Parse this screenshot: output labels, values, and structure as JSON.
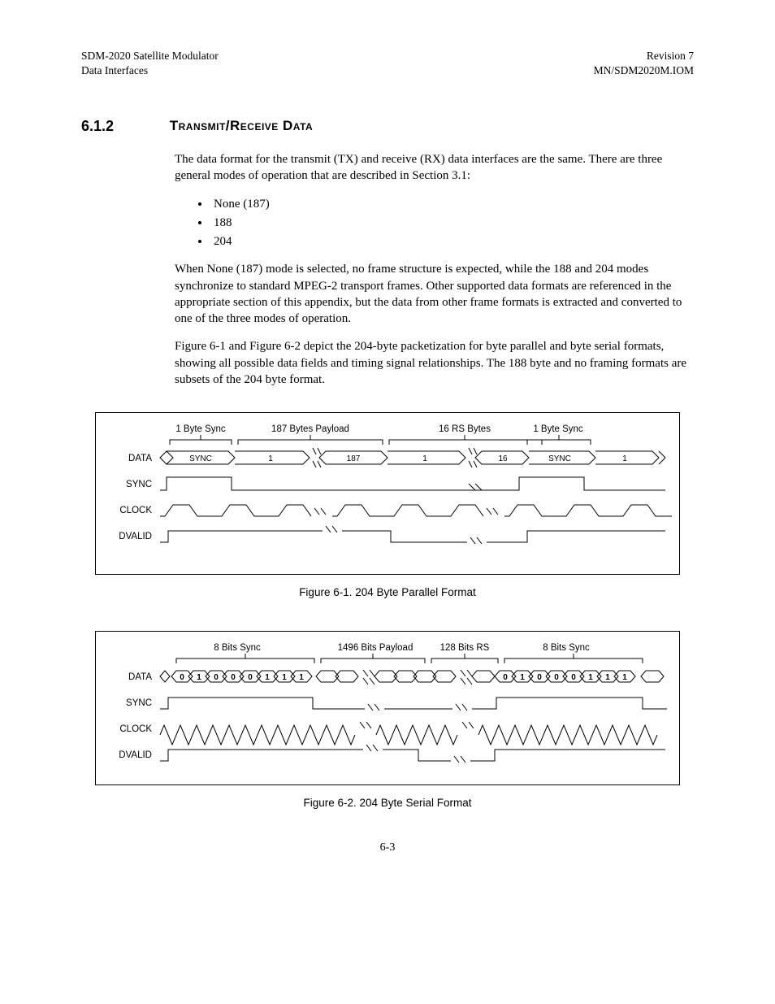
{
  "header": {
    "left1": "SDM-2020 Satellite Modulator",
    "left2": "Data Interfaces",
    "right1": "Revision 7",
    "right2": "MN/SDM2020M.IOM"
  },
  "section": {
    "num": "6.1.2",
    "title": "Transmit/Receive Data"
  },
  "p1": "The data format for the transmit (TX) and receive (RX) data interfaces are the same. There are three general modes of operation that are described in Section 3.1:",
  "bullets": [
    "None (187)",
    "188",
    "204"
  ],
  "p2": "When None (187) mode is selected, no frame structure is expected, while the 188 and 204 modes synchronize to standard MPEG-2 transport frames. Other supported data formats are referenced in the appropriate section of this appendix, but the data from other frame formats is extracted and converted to one of the three modes of operation.",
  "p3": "Figure 6-1 and Figure 6-2 depict the 204-byte packetization for byte parallel and byte serial formats, showing all possible data fields and timing signal relationships. The 188 byte and no framing formats are subsets of the 204 byte format.",
  "fig1": {
    "caption": "Figure 6-1.  204 Byte Parallel Format",
    "top_labels": [
      "1 Byte Sync",
      "187 Bytes Payload",
      "16 RS Bytes",
      "1 Byte Sync"
    ],
    "row_labels": [
      "DATA",
      "SYNC",
      "CLOCK",
      "DVALID"
    ],
    "data_cells": [
      "SYNC",
      "1",
      "187",
      "1",
      "16",
      "SYNC",
      "1"
    ]
  },
  "fig2": {
    "caption": "Figure 6-2.  204 Byte Serial Format",
    "top_labels": [
      "8 Bits Sync",
      "1496 Bits Payload",
      "128 Bits RS",
      "8 Bits Sync"
    ],
    "row_labels": [
      "DATA",
      "SYNC",
      "CLOCK",
      "DVALID"
    ],
    "sync_bits_left": [
      "0",
      "1",
      "0",
      "0",
      "0",
      "1",
      "1",
      "1"
    ],
    "sync_bits_right": [
      "0",
      "1",
      "0",
      "0",
      "0",
      "1",
      "1",
      "1"
    ]
  },
  "page_num": "6-3"
}
